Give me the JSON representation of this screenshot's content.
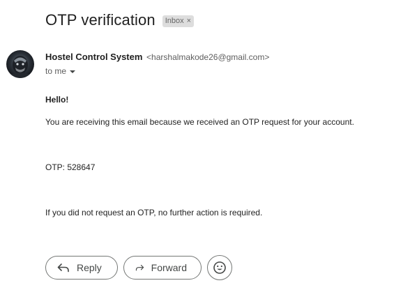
{
  "email": {
    "subject": "OTP verification",
    "label": "Inbox",
    "label_remove": "×",
    "sender": {
      "name": "Hostel Control System",
      "address": "<harshalmakode26@gmail.com>",
      "avatar_icon": "sender-avatar-photo"
    },
    "recipient_line": "to me",
    "body": {
      "greeting": "Hello!",
      "line1": "You are receiving this email because we received an OTP request for your account.",
      "otp_line": "OTP: 528647",
      "line3": "If you did not request an OTP, no further action is required."
    }
  },
  "actions": {
    "reply_label": "Reply",
    "forward_label": "Forward",
    "reply_icon": "reply-arrow-icon",
    "forward_icon": "forward-arrow-icon",
    "emoji_icon": "smiley-face-icon"
  },
  "colors": {
    "label_chip_bg": "#dddddd",
    "button_border": "#747775",
    "text_primary": "#1f1f1f",
    "text_secondary": "#5e5e5e"
  }
}
